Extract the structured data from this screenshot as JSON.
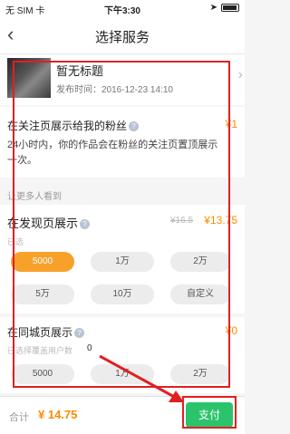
{
  "status": {
    "carrier": "无 SIM 卡",
    "time": "下午3:30"
  },
  "nav": {
    "title": "选择服务"
  },
  "video": {
    "title": "暂无标题",
    "date": "发布时间：2016-12-23 14:10"
  },
  "section1": {
    "title": "在关注页展示给我的粉丝",
    "price": "¥1",
    "description": "24小时内，你的作品会在粉丝的关注页置顶展示一次。"
  },
  "more_label": "让更多人看到",
  "section2": {
    "title": "在发现页展示",
    "old_price": "¥16.5",
    "new_price": "¥13.75",
    "hint": "已选",
    "options": [
      "5000",
      "1万",
      "2万",
      "5万",
      "10万",
      "自定义"
    ]
  },
  "section3": {
    "title": "在同城页展示",
    "price": "¥0",
    "hint": "已选择覆盖用户数",
    "count": "0",
    "options": [
      "5000",
      "1万",
      "2万"
    ]
  },
  "footer": {
    "total_label": "合计",
    "total_value": "¥ 14.75",
    "pay_label": "支付"
  },
  "colors": {
    "accent_orange": "#f7a12b",
    "pay_green": "#2bc46c",
    "annotation_red": "#e02020"
  }
}
